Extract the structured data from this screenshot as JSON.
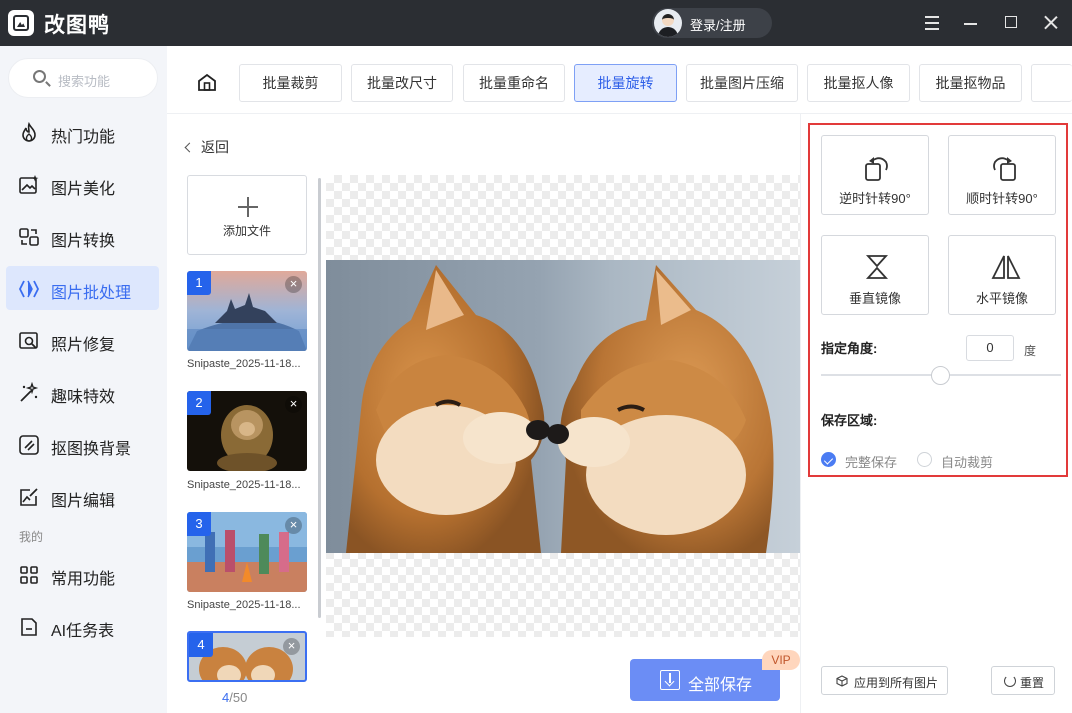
{
  "app": {
    "name": "改图鸭",
    "login_label": "登录/注册"
  },
  "sidebar": {
    "search_placeholder": "搜索功能",
    "items": [
      {
        "label": "热门功能",
        "icon": "flame-icon"
      },
      {
        "label": "图片美化",
        "icon": "image-sparkle-icon"
      },
      {
        "label": "图片转换",
        "icon": "convert-icon"
      },
      {
        "label": "图片批处理",
        "icon": "batch-icon",
        "active": true
      },
      {
        "label": "照片修复",
        "icon": "photo-repair-icon"
      },
      {
        "label": "趣味特效",
        "icon": "magic-wand-icon"
      },
      {
        "label": "抠图换背景",
        "icon": "cutout-icon"
      },
      {
        "label": "图片编辑",
        "icon": "edit-image-icon"
      }
    ],
    "section_mine": "我的",
    "mine_items": [
      {
        "label": "常用功能",
        "icon": "grid-icon"
      },
      {
        "label": "AI任务表",
        "icon": "document-icon"
      }
    ]
  },
  "tabs": [
    {
      "label": "批量裁剪"
    },
    {
      "label": "批量改尺寸"
    },
    {
      "label": "批量重命名"
    },
    {
      "label": "批量旋转",
      "active": true
    },
    {
      "label": "批量图片压缩"
    },
    {
      "label": "批量抠人像"
    },
    {
      "label": "批量抠物品"
    }
  ],
  "filelist": {
    "back_label": "返回",
    "add_label": "添加文件",
    "items": [
      {
        "num": "1",
        "name": "Snipaste_2025-11-18..."
      },
      {
        "num": "2",
        "name": "Snipaste_2025-11-18..."
      },
      {
        "num": "3",
        "name": "Snipaste_2025-11-18..."
      },
      {
        "num": "4",
        "name": ""
      }
    ],
    "current": "4",
    "total": "/50"
  },
  "actions": {
    "save_all": "全部保存",
    "vip": "VIP"
  },
  "rotate_panel": {
    "ccw": "逆时针转90°",
    "cw": "顺时针转90°",
    "vflip": "垂直镜像",
    "hflip": "水平镜像",
    "angle_label": "指定角度:",
    "angle_value": "0",
    "angle_unit": "度",
    "angle_slider_fraction": 0.5,
    "save_area_label": "保存区域:",
    "opt_full": "完整保存",
    "opt_auto_crop": "自动裁剪",
    "apply_all": "应用到所有图片",
    "reset": "重置"
  },
  "colors": {
    "accent": "#3a6df0",
    "titlebar": "#2b2e33",
    "highlight_frame": "#e23a3a"
  }
}
